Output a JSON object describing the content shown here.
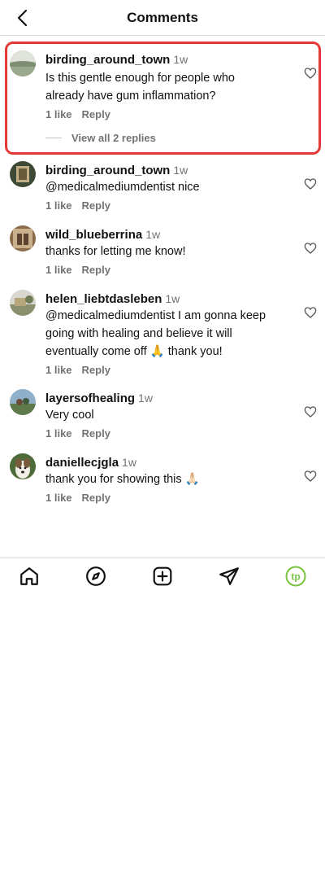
{
  "header": {
    "title": "Comments"
  },
  "comments": [
    {
      "username": "birding_around_town",
      "time": "1w",
      "text_lines": [
        "Is this gentle enough for people who",
        "already have gum inflammation?"
      ],
      "likes": "1 like",
      "reply": "Reply",
      "view_replies": "View all 2 replies"
    },
    {
      "username": "birding_around_town",
      "time": "1w",
      "text_lines": [
        "@medicalmediumdentist nice"
      ],
      "likes": "1 like",
      "reply": "Reply"
    },
    {
      "username": "wild_blueberrina",
      "time": "1w",
      "text_lines": [
        "thanks for letting me know!"
      ],
      "likes": "1 like",
      "reply": "Reply"
    },
    {
      "username": "helen_liebtdasleben",
      "time": "1w",
      "text_lines": [
        "@medicalmediumdentist I am gonna keep",
        "going with healing and believe it will",
        "eventually come off 🙏 thank you!"
      ],
      "likes": "1 like",
      "reply": "Reply"
    },
    {
      "username": "layersofhealing",
      "time": "1w",
      "text_lines": [
        "Very cool"
      ],
      "likes": "1 like",
      "reply": "Reply"
    },
    {
      "username": "daniellecjgla",
      "time": "1w",
      "text_lines": [
        "thank you for showing this 🙏🏻"
      ],
      "likes": "1 like",
      "reply": "Reply"
    }
  ],
  "nav": {
    "icons": [
      "home-icon",
      "explore-icon",
      "create-icon",
      "send-icon",
      "profile-icon"
    ],
    "profile_initials": "tp",
    "profile_color": "#7cc242"
  },
  "colors": {
    "highlight": "#e53935",
    "secondary_text": "#737373"
  }
}
